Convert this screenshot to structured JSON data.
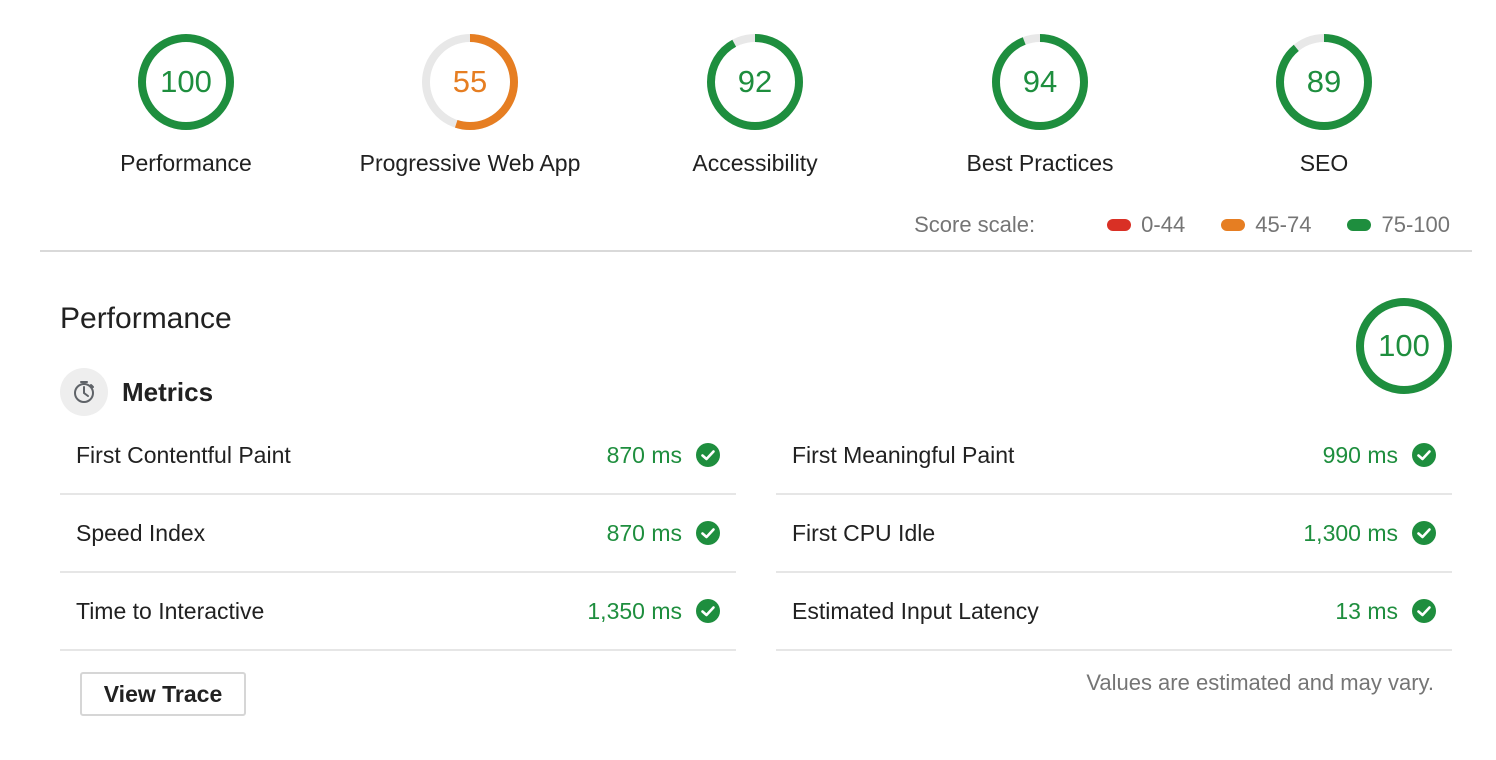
{
  "colors": {
    "pass": "#1e8e3e",
    "average": "#e67e22",
    "fail": "#d93025",
    "track": "#e8e8e8"
  },
  "categories": [
    {
      "label": "Performance",
      "score": "100",
      "score_fraction": 1.0,
      "color": "#1e8e3e"
    },
    {
      "label": "Progressive Web App",
      "score": "55",
      "score_fraction": 0.55,
      "color": "#e67e22"
    },
    {
      "label": "Accessibility",
      "score": "92",
      "score_fraction": 0.92,
      "color": "#1e8e3e"
    },
    {
      "label": "Best Practices",
      "score": "94",
      "score_fraction": 0.94,
      "color": "#1e8e3e"
    },
    {
      "label": "SEO",
      "score": "89",
      "score_fraction": 0.89,
      "color": "#1e8e3e"
    }
  ],
  "score_scale": {
    "title": "Score scale:",
    "ranges": [
      {
        "label": "0-44",
        "color": "#d93025"
      },
      {
        "label": "45-74",
        "color": "#e67e22"
      },
      {
        "label": "75-100",
        "color": "#1e8e3e"
      }
    ]
  },
  "performance": {
    "title": "Performance",
    "score": "100",
    "score_fraction": 1.0,
    "metrics_title": "Metrics",
    "metrics_icon": "stopwatch-icon",
    "left_metrics": [
      {
        "name": "First Contentful Paint",
        "value": "870 ms"
      },
      {
        "name": "Speed Index",
        "value": "870 ms"
      },
      {
        "name": "Time to Interactive",
        "value": "1,350 ms"
      }
    ],
    "right_metrics": [
      {
        "name": "First Meaningful Paint",
        "value": "990 ms"
      },
      {
        "name": "First CPU Idle",
        "value": "1,300 ms"
      },
      {
        "name": "Estimated Input Latency",
        "value": "13 ms"
      }
    ],
    "view_trace_label": "View Trace",
    "footnote": "Values are estimated and may vary."
  }
}
